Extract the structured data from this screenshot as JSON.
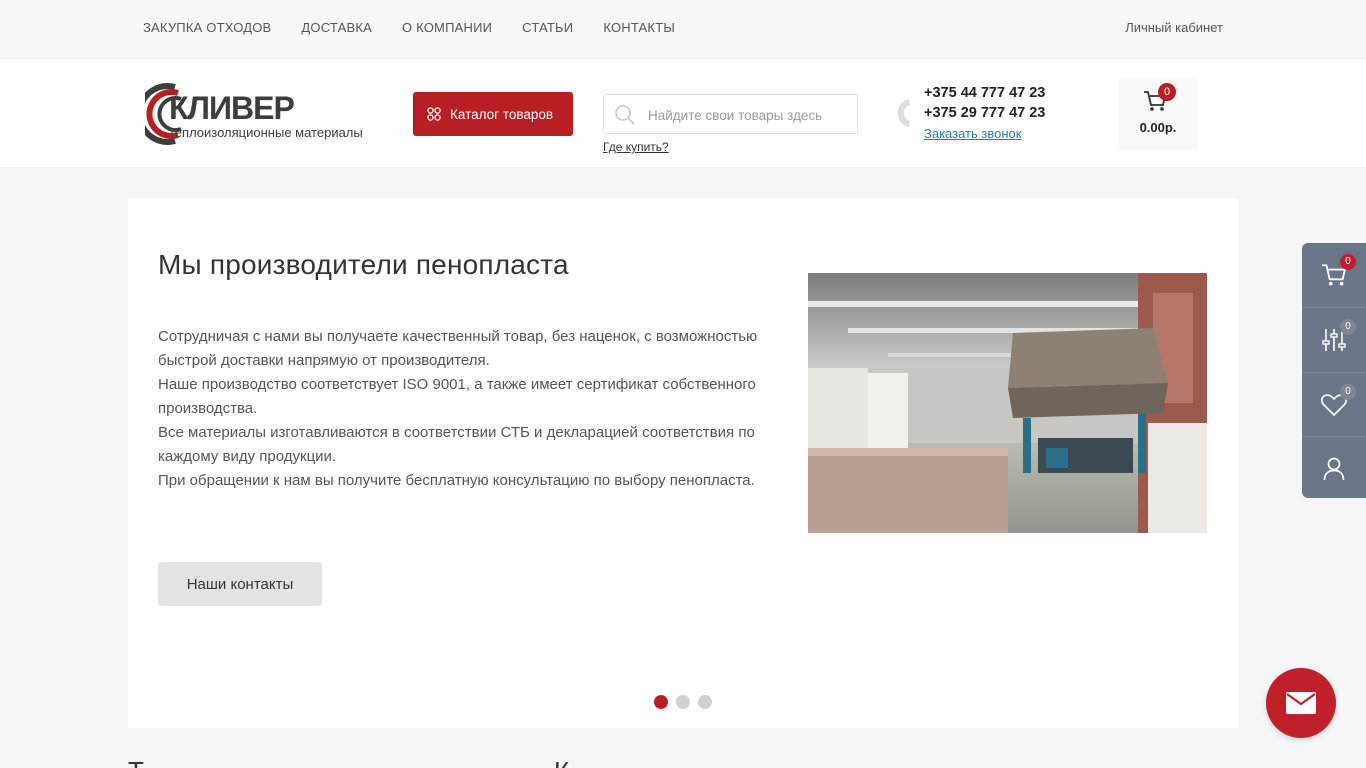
{
  "topnav": {
    "items": [
      {
        "label": "ЗАКУПКА ОТХОДОВ"
      },
      {
        "label": "ДОСТАВКА"
      },
      {
        "label": "О КОМПАНИИ"
      },
      {
        "label": "СТАТЬИ"
      },
      {
        "label": "КОНТАКТЫ"
      }
    ],
    "cabinet_label": "Личный кабинет"
  },
  "header": {
    "logo": {
      "word": "КЛИВЕР",
      "subtitle": "теплоизоляционные материалы"
    },
    "catalog_label": "Каталог товаров",
    "search_placeholder": "Найдите свои товары здесь",
    "where_buy_label": "Где купить?",
    "phones": [
      "+375 44 777 47 23",
      "+375 29 777 47 23"
    ],
    "callback_label": "Заказать звонок",
    "cart": {
      "count": "0",
      "total": "0.00р."
    }
  },
  "slider": {
    "title": "Мы производители пенопласта",
    "paragraphs": [
      "Сотрудничая с нами вы получаете качественный товар, без наценок, с возможностью быстрой доставки напрямую от производителя.",
      "Наше производство соответствует ISO 9001, а также имеет сертификат собственного производства.",
      "Все материалы изготавливаются в соответствии СТБ и декларацией соответствия по каждому виду продукции.",
      "При обращении к нам вы получите бесплатную консультацию по выбору пенопласта."
    ],
    "button_label": "Наши контакты",
    "active_slide": 1,
    "slide_count": 3
  },
  "side_panel": {
    "cart_count": "0",
    "compare_count": "0",
    "favorites_count": "0"
  },
  "below": {
    "left_heading_start": "Т",
    "right_heading_start": "К"
  },
  "colors": {
    "accent": "#b71f24",
    "link": "#1c7fb5",
    "side_panel": "#6b7588"
  },
  "icons": [
    "grid-icon",
    "search-icon",
    "phone-icon",
    "cart-icon",
    "compare-icon",
    "heart-icon",
    "user-icon",
    "mail-icon"
  ]
}
